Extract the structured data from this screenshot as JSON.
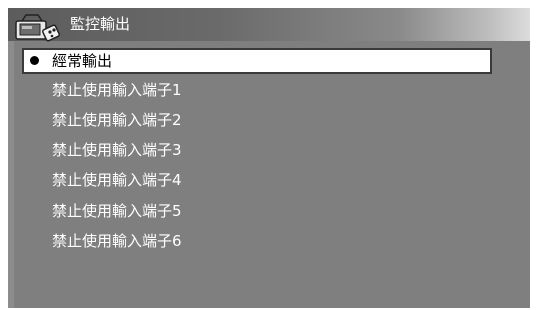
{
  "window": {
    "title": "監控輸出",
    "icon": "tv-remote-icon"
  },
  "menu": {
    "selected_index": 0,
    "items": [
      {
        "label": "經常輸出"
      },
      {
        "label": "禁止使用輸入端子1"
      },
      {
        "label": "禁止使用輸入端子2"
      },
      {
        "label": "禁止使用輸入端子3"
      },
      {
        "label": "禁止使用輸入端子4"
      },
      {
        "label": "禁止使用輸入端子5"
      },
      {
        "label": "禁止使用輸入端子6"
      }
    ]
  },
  "colors": {
    "background": "#7f7f7f",
    "selected_bg": "#ffffff",
    "text": "#ffffff"
  }
}
